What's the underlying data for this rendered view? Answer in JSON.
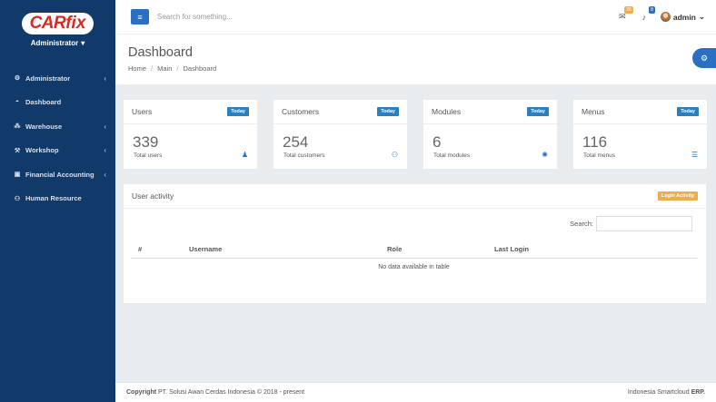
{
  "brand": {
    "logo_car": "CAR",
    "logo_fix": "fix",
    "role": "Administrator",
    "role_caret": "▾"
  },
  "sidebar": {
    "items": [
      {
        "label": "Administrator",
        "icon": "cogs-icon",
        "glyph": "⚙",
        "chevron": "‹"
      },
      {
        "label": "Dashboard",
        "icon": "dashboard-icon",
        "glyph": "◓",
        "chevron": ""
      },
      {
        "label": "Warehouse",
        "icon": "cubes-icon",
        "glyph": "⁂",
        "chevron": "‹"
      },
      {
        "label": "Workshop",
        "icon": "wrench-icon",
        "glyph": "⚒",
        "chevron": "‹"
      },
      {
        "label": "Financial Accounting",
        "icon": "money-icon",
        "glyph": "▣",
        "chevron": "‹"
      },
      {
        "label": "Human Resource",
        "icon": "users-icon",
        "glyph": "⚇",
        "chevron": ""
      }
    ]
  },
  "topbar": {
    "menu_glyph": "≡",
    "search_placeholder": "Search for something...",
    "notif_mail_count": "26",
    "notif_bell_count": "8",
    "user_name": "admin",
    "user_caret": "⌄"
  },
  "page": {
    "title": "Dashboard",
    "breadcrumb": [
      "Home",
      "Main",
      "Dashboard"
    ],
    "breadcrumb_sep": "/",
    "fab_glyph": "⚙"
  },
  "cards": [
    {
      "title": "Users",
      "badge": "Today",
      "value": "339",
      "sub": "Total users",
      "icon": "user-icon",
      "glyph": "♟"
    },
    {
      "title": "Customers",
      "badge": "Today",
      "value": "254",
      "sub": "Total customers",
      "icon": "users-icon",
      "glyph": "⚇"
    },
    {
      "title": "Modules",
      "badge": "Today",
      "value": "6",
      "sub": "Total modules",
      "icon": "cog-icon",
      "glyph": "✺"
    },
    {
      "title": "Menus",
      "badge": "Today",
      "value": "116",
      "sub": "Total menus",
      "icon": "list-icon",
      "glyph": "☰"
    }
  ],
  "activity": {
    "title": "User activity",
    "badge": "Login Activity",
    "search_label": "Search:",
    "columns": [
      "#",
      "Username",
      "Role",
      "Last Login"
    ],
    "empty": "No data available in table"
  },
  "footer": {
    "copyright_bold": "Copyright",
    "copyright_text": "PT. Solusi Awan Cerdas Indonesia © 2018 - present",
    "right_text": "Indonesia Smartcloud",
    "right_bold": "ERP."
  },
  "colors": {
    "sidebar": "#113a6a",
    "accent": "#2a6fc4",
    "badge_orange": "#f0ad4e"
  }
}
